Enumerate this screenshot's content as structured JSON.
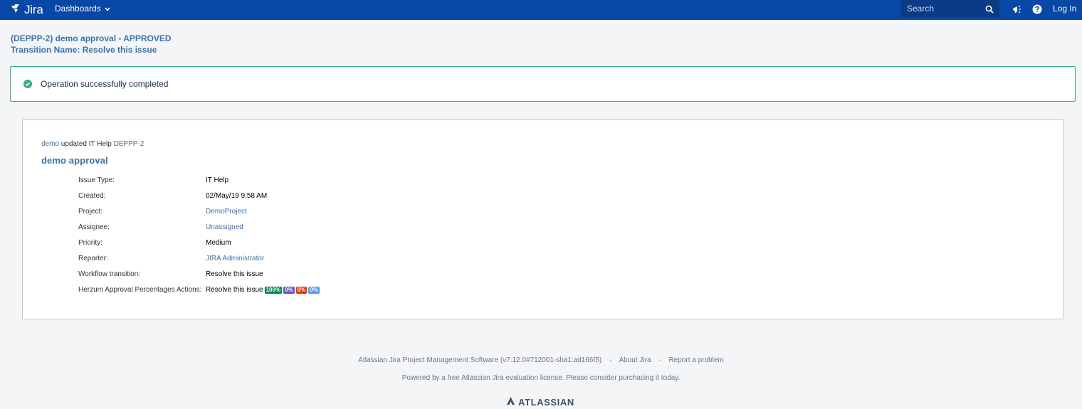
{
  "header": {
    "logo_text": "Jira",
    "dashboards_label": "Dashboards",
    "search_placeholder": "Search",
    "login_label": "Log In"
  },
  "page": {
    "title_line1": "(DEPPP-2) demo approval - APPROVED",
    "title_line2": "Transition Name: Resolve this issue"
  },
  "message": {
    "text": "Operation successfully completed",
    "color": "#36b37e"
  },
  "card": {
    "user_link": "demo",
    "action_text": " updated IT Help ",
    "issue_key": "DEPPP-2",
    "issue_title": "demo approval",
    "fields": [
      {
        "label": "Issue Type:",
        "value": "IT Help",
        "link": false
      },
      {
        "label": "Created:",
        "value": "02/May/19 9:58 AM",
        "link": false
      },
      {
        "label": "Project:",
        "value": "DemoProject",
        "link": true
      },
      {
        "label": "Assignee:",
        "value": "Unassigned",
        "link": true
      },
      {
        "label": "Priority:",
        "value": "Medium",
        "link": false
      },
      {
        "label": "Reporter:",
        "value": "JIRA Administrator",
        "link": true
      },
      {
        "label": "Workflow transition:",
        "value": "Resolve this issue",
        "link": false
      },
      {
        "label": "Herzum Approval Percentages Actions:",
        "value": "Resolve this issue",
        "link": false
      }
    ],
    "badges": [
      {
        "text": "100%",
        "color": "#00875a"
      },
      {
        "text": "0%",
        "color": "#6554c0"
      },
      {
        "text": "0%",
        "color": "#de350b"
      },
      {
        "text": "0%",
        "color": "#4c9aff"
      }
    ]
  },
  "footer": {
    "software": "Atlassian Jira Project Management Software (v7.12.0#712001-sha1:ad166f5)",
    "about": "About Jira",
    "report": "Report a problem",
    "separator": "·",
    "powered": "Powered by a free Atlassian Jira evaluation license. Please consider purchasing it today.",
    "brand": "ATLASSIAN"
  }
}
